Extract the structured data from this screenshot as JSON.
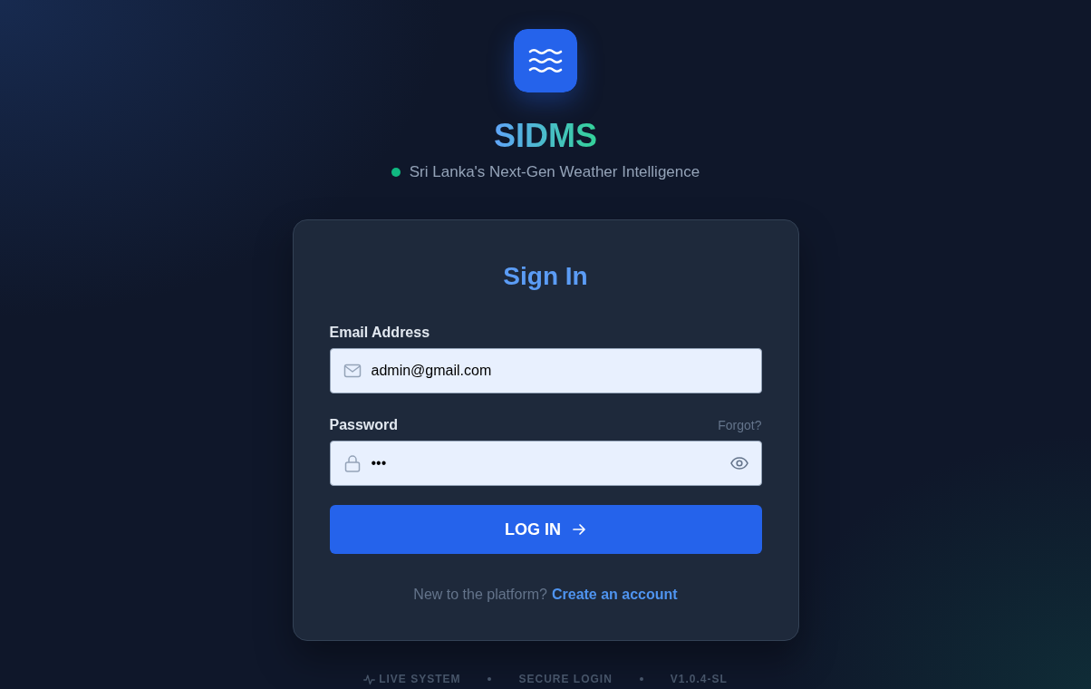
{
  "brand": {
    "name": "SIDMS",
    "tagline": "Sri Lanka's Next-Gen Weather Intelligence",
    "online": true
  },
  "login_card": {
    "title": "Sign In",
    "fields": [
      {
        "kind": "email",
        "label": "Email Address",
        "value": "admin@gmail.com"
      },
      {
        "kind": "password",
        "label": "Password",
        "link": "Forgot?",
        "value": "•••"
      }
    ],
    "submit": "LOG IN",
    "signup_prompt": "New to the platform?",
    "signup_link": "Create an account"
  },
  "footer": [
    {
      "kind": "live",
      "label": "LIVE SYSTEM"
    },
    {
      "kind": "plain",
      "label": "SECURE LOGIN"
    },
    {
      "kind": "plain",
      "label": "V1.0.4-SL"
    }
  ]
}
